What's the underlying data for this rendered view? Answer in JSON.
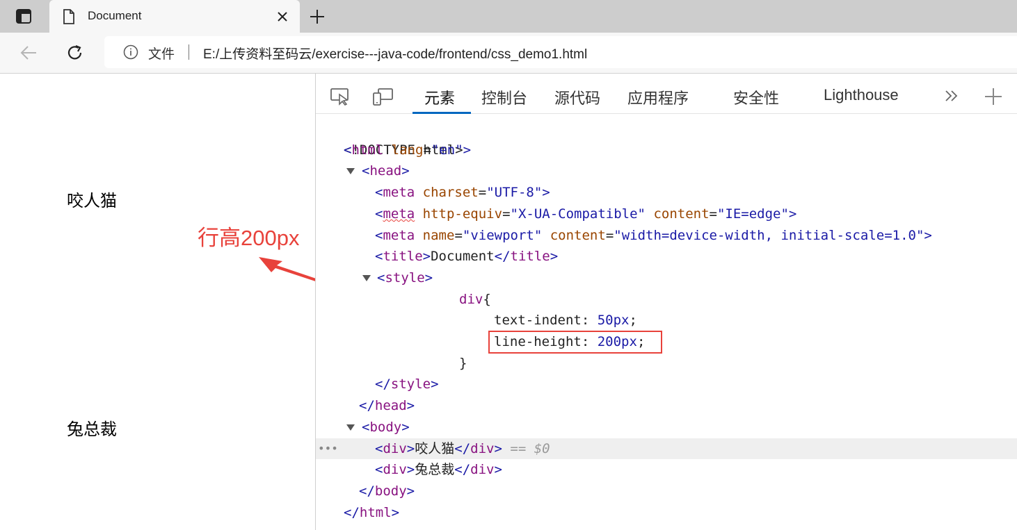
{
  "browser": {
    "tab_title": "Document",
    "site_label": "文件",
    "url": "E:/上传资料至码云/exercise---java-code/frontend/css_demo1.html"
  },
  "page": {
    "line1": "咬人猫",
    "line2": "兔总裁",
    "annotation": "行高200px",
    "annotation_color": "#e8423b"
  },
  "devtools": {
    "tabs": [
      "元素",
      "控制台",
      "源代码",
      "应用程序",
      "安全性",
      "Lighthouse"
    ],
    "active_tab": "元素",
    "accent_color": "#0067c0",
    "code": {
      "doctype": "<!DOCTYPE html>",
      "html_open": "html",
      "html_attr": "lang",
      "html_attr_val": "\"en\"",
      "head": "head",
      "meta": "meta",
      "charset_attr": "charset",
      "charset_val": "\"UTF-8\"",
      "http_equiv_attr": "http-equiv",
      "http_equiv_val": "\"X-UA-Compatible\"",
      "content_attr": "content",
      "content_val1": "\"IE=edge\"",
      "name_attr": "name",
      "name_val": "\"viewport\"",
      "content_val2": "\"width=device-width, initial-scale=1.0\"",
      "title": "title",
      "title_text": "Document",
      "style": "style",
      "selector": "div",
      "prop1": "text-indent",
      "val1": "50px",
      "prop2": "line-height",
      "val2": "200px",
      "body": "body",
      "div": "div",
      "div1_text": "咬人猫",
      "div2_text": "兔总裁",
      "eq": "== $0"
    }
  }
}
